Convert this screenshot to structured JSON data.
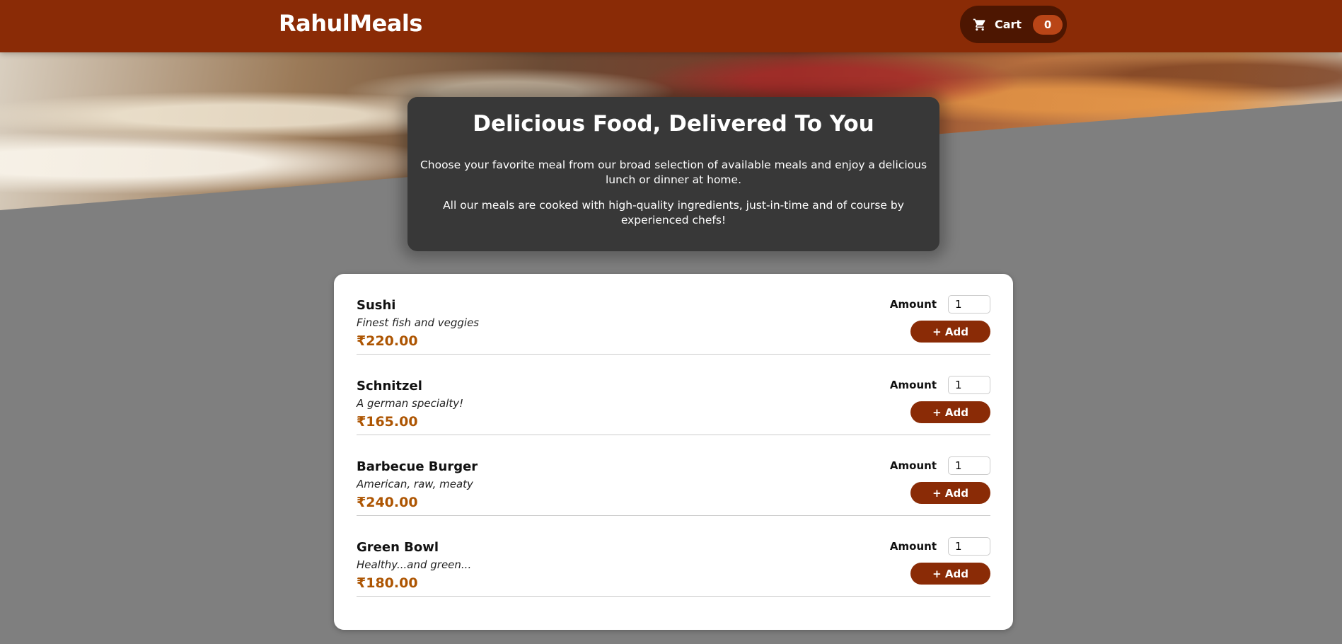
{
  "header": {
    "logo": "RahulMeals",
    "cart_label": "Cart",
    "cart_count": "0",
    "cart_icon": "shopping-cart-icon"
  },
  "summary": {
    "title": "Delicious Food, Delivered To You",
    "paragraph1": "Choose your favorite meal from our broad selection of available meals and enjoy a delicious lunch or dinner at home.",
    "paragraph2": "All our meals are cooked with high-quality ingredients, just-in-time and of course by experienced chefs!"
  },
  "meals": [
    {
      "name": "Sushi",
      "description": "Finest fish and veggies",
      "price": "₹220.00",
      "amount_label": "Amount",
      "amount": "1",
      "add_label": "+ Add"
    },
    {
      "name": "Schnitzel",
      "description": "A german specialty!",
      "price": "₹165.00",
      "amount_label": "Amount",
      "amount": "1",
      "add_label": "+ Add"
    },
    {
      "name": "Barbecue Burger",
      "description": "American, raw, meaty",
      "price": "₹240.00",
      "amount_label": "Amount",
      "amount": "1",
      "add_label": "+ Add"
    },
    {
      "name": "Green Bowl",
      "description": "Healthy...and green...",
      "price": "₹180.00",
      "amount_label": "Amount",
      "amount": "1",
      "add_label": "+ Add"
    }
  ],
  "colors": {
    "header_bg": "#8a2b06",
    "cart_bg": "#4d1601",
    "badge_bg": "#b94517",
    "price": "#ad5502",
    "page_bg": "#7f7f7f"
  }
}
